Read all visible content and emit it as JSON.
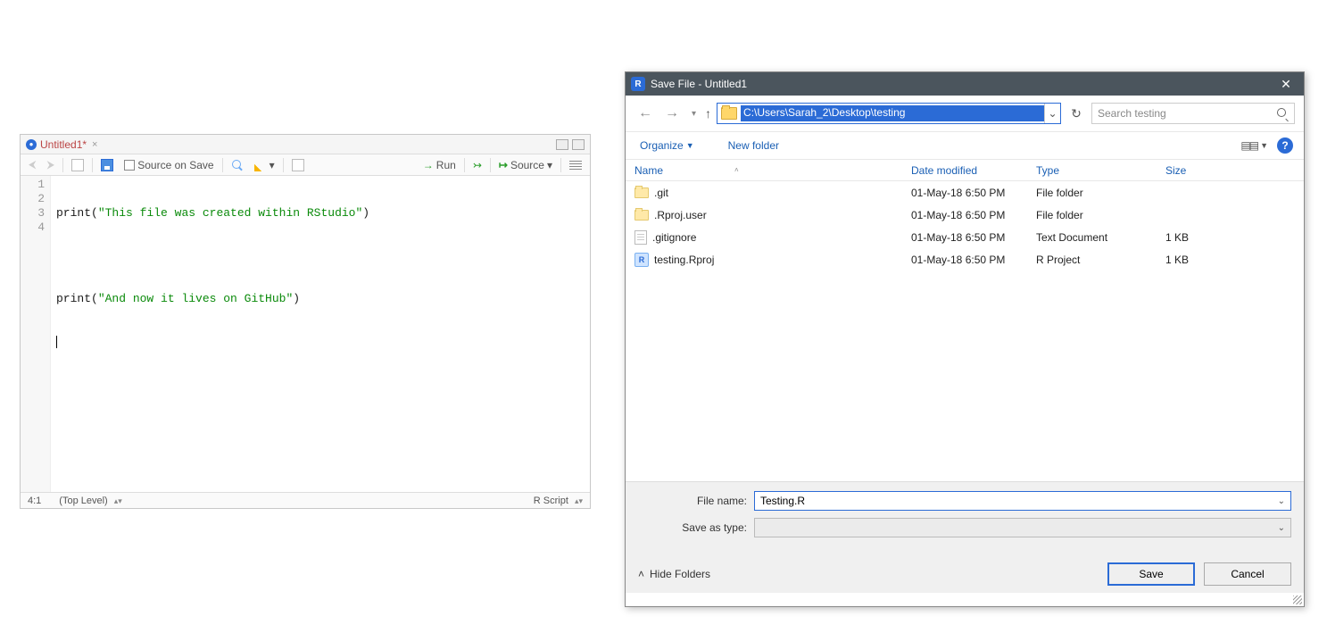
{
  "editor": {
    "tab_title": "Untitled1*",
    "tab_close": "×",
    "toolbar": {
      "source_on_save": "Source on Save",
      "run": "Run",
      "source": "Source"
    },
    "code_lines": [
      "1",
      "2",
      "3",
      "4"
    ],
    "code": {
      "l1_fn": "print",
      "l1_str": "\"This file was created within RStudio\"",
      "l3_fn": "print",
      "l3_str": "\"And now it lives on GitHub\""
    },
    "status": {
      "pos": "4:1",
      "scope": "(Top Level)",
      "lang": "R Script"
    }
  },
  "dialog": {
    "title": "Save File - Untitled1",
    "address": "C:\\Users\\Sarah_2\\Desktop\\testing",
    "search_placeholder": "Search testing",
    "organize": "Organize",
    "new_folder": "New folder",
    "columns": {
      "name": "Name",
      "date": "Date modified",
      "type": "Type",
      "size": "Size"
    },
    "rows": [
      {
        "icon": "folder",
        "name": ".git",
        "date": "01-May-18 6:50 PM",
        "type": "File folder",
        "size": ""
      },
      {
        "icon": "folder",
        "name": ".Rproj.user",
        "date": "01-May-18 6:50 PM",
        "type": "File folder",
        "size": ""
      },
      {
        "icon": "doc",
        "name": ".gitignore",
        "date": "01-May-18 6:50 PM",
        "type": "Text Document",
        "size": "1 KB"
      },
      {
        "icon": "rproj",
        "name": "testing.Rproj",
        "date": "01-May-18 6:50 PM",
        "type": "R Project",
        "size": "1 KB"
      }
    ],
    "file_name_label": "File name:",
    "file_name_value": "Testing.R",
    "save_as_type_label": "Save as type:",
    "save_as_type_value": "",
    "hide_folders": "Hide Folders",
    "save": "Save",
    "cancel": "Cancel"
  }
}
